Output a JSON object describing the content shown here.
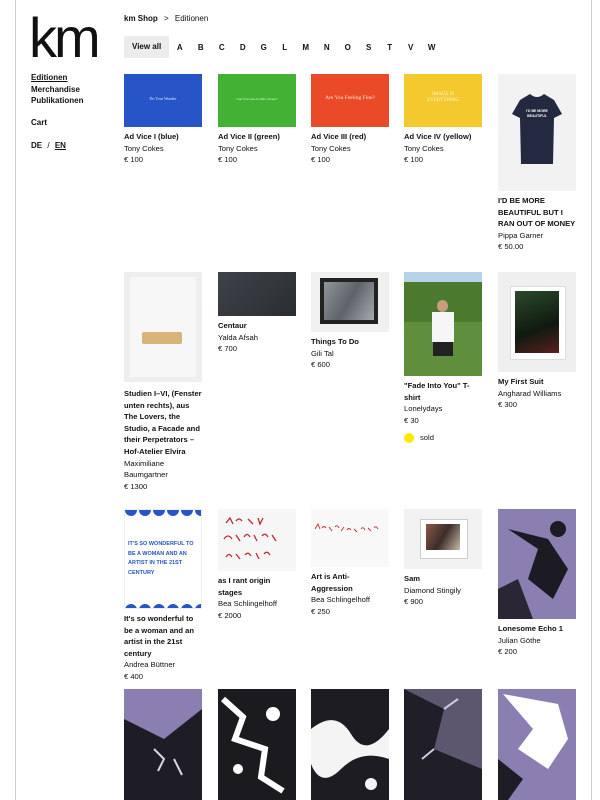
{
  "logo": "km",
  "nav": {
    "items": [
      "Editionen",
      "Merchandise",
      "Publikationen"
    ],
    "cart": "Cart",
    "lang": {
      "de": "DE",
      "sep": "/",
      "en": "EN"
    }
  },
  "breadcrumb": {
    "shop": "km Shop",
    "sep": ">",
    "current": "Editionen"
  },
  "filter": {
    "view_all": "View all",
    "letters": [
      "A",
      "B",
      "C",
      "D",
      "G",
      "L",
      "M",
      "N",
      "O",
      "S",
      "T",
      "V",
      "W"
    ]
  },
  "colors": {
    "blue": "#2754c6",
    "green": "#43b234",
    "red": "#ea4a28",
    "yellow": "#f4c92e",
    "navy": "#23293f",
    "purple": "#8a7fb0",
    "sold": "#ffeb00"
  },
  "products": [
    {
      "title": "Ad Vice I (blue)",
      "artist": "Tony Cokes",
      "price": "€ 100",
      "img_text": "Do Your Wonder"
    },
    {
      "title": "Ad Vice II (green)",
      "artist": "Tony Cokes",
      "price": "€ 100",
      "img_text": "Can You Get A Little Closer?"
    },
    {
      "title": "Ad Vice III (red)",
      "artist": "Tony Cokes",
      "price": "€ 100",
      "img_text": "Are You Feeling Fine?"
    },
    {
      "title": "Ad Vice IV (yellow)",
      "artist": "Tony Cokes",
      "price": "€ 100",
      "img_text": "IMAGE IS EVERYTHING"
    },
    {
      "title": "I'D BE MORE BEAUTIFUL BUT I RAN OUT OF MONEY",
      "artist": "Pippa Garner",
      "price": "€ 50.00",
      "img_text": "I'D BE MORE BEAUTIFUL"
    },
    {
      "title": "Studien I–VI, (Fenster unten rechts), aus The Lovers, the Studio, a Facade and their Perpetrators – Hof-Atelier Elvira",
      "artist": "Maximiliane Baumgartner",
      "price": "€ 1300"
    },
    {
      "title": "Centaur",
      "artist": "Yalda Afsah",
      "price": "€ 700"
    },
    {
      "title": "Things To Do",
      "artist": "Gili Tal",
      "price": "€ 600"
    },
    {
      "title": "\"Fade Into You\" T-shirt",
      "artist": "Lonelydays",
      "price": "€ 30",
      "status": "sold"
    },
    {
      "title": "My First Suit",
      "artist": "Angharad Williams",
      "price": "€ 300"
    },
    {
      "title": "It's so wonderful to be a woman and an artist in the 21st century",
      "artist": "Andrea Büttner",
      "price": "€ 400",
      "img_text": "IT'S SO WONDERFUL TO BE A WOMAN AND AN ARTIST IN THE 21ST CENTURY"
    },
    {
      "title": "as I rant origin stages",
      "artist": "Bea Schlingelhoff",
      "price": "€ 2000"
    },
    {
      "title": "Art is Anti-Aggression",
      "artist": "Bea Schlingelhoff",
      "price": "€ 250"
    },
    {
      "title": "Sam",
      "artist": "Diamond Stingily",
      "price": "€ 900"
    },
    {
      "title": "Lonesome Echo 1",
      "artist": "Julian Göthe",
      "price": "€ 200"
    }
  ]
}
